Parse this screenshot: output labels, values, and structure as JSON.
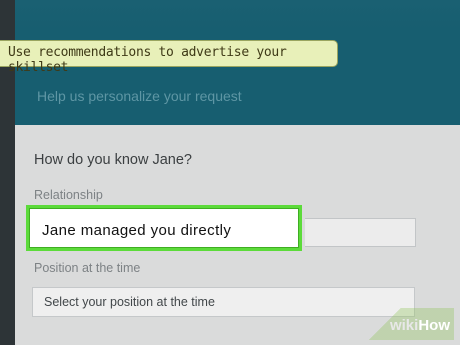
{
  "caption": "Use recommendations to advertise your skillset",
  "dialog": {
    "subtitle": "Help us personalize your request",
    "question": "How do you know Jane?",
    "relationship": {
      "label": "Relationship",
      "value": "Jane managed you directly"
    },
    "position": {
      "label": "Position at the time",
      "placeholder": "Select your position at the time"
    }
  },
  "watermark": {
    "prefix": "wiki",
    "suffix": "How"
  },
  "colors": {
    "header_teal": "#175e70",
    "highlight_green": "#5cdb3a",
    "caption_bg": "#e8f0b9"
  }
}
